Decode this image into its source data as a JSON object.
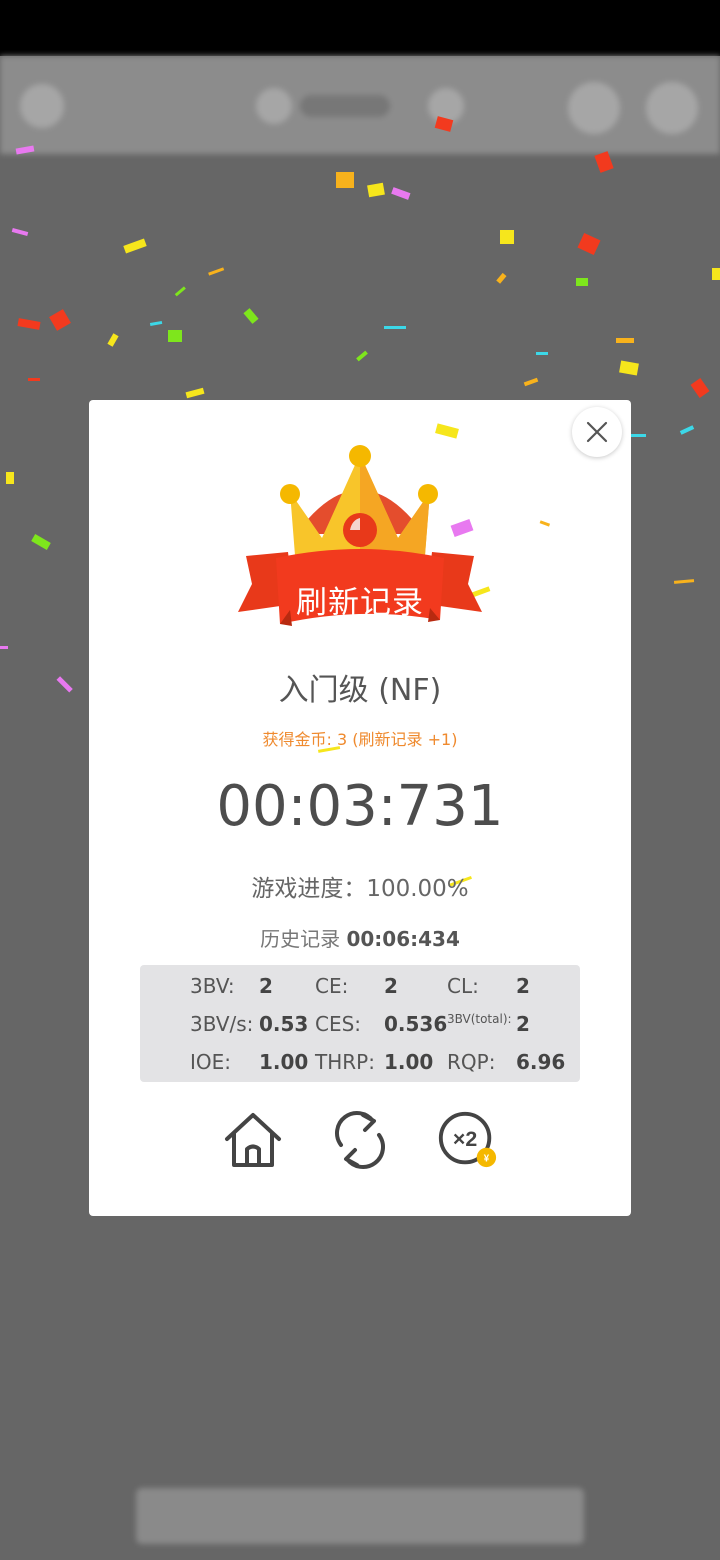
{
  "dialog": {
    "banner_text": "刷新记录",
    "level": "入门级 (NF)",
    "coins": "获得金币: 3 (刷新记录 +1)",
    "time": "00:03:731",
    "progress_label": "游戏进度：",
    "progress_value": "100.00%",
    "history_label": "历史记录",
    "history_value": "00:06:434",
    "stats": {
      "bv": {
        "label": "3BV:",
        "value": "2"
      },
      "ce": {
        "label": "CE:",
        "value": "2"
      },
      "cl": {
        "label": "CL:",
        "value": "2"
      },
      "bvs": {
        "label": "3BV/s:",
        "value": "0.53"
      },
      "ces": {
        "label": "CES:",
        "value": "0.536"
      },
      "bvtotal": {
        "label": "3BV(total):",
        "value": "2"
      },
      "ioe": {
        "label": "IOE:",
        "value": "1.00"
      },
      "thrp": {
        "label": "THRP:",
        "value": "1.00"
      },
      "rqp": {
        "label": "RQP:",
        "value": "6.96"
      }
    },
    "actions": {
      "home_icon": "home-icon",
      "restart_icon": "refresh-icon",
      "double_icon": "x2-coin-icon",
      "double_text": "×2",
      "coin_symbol": "¥"
    }
  },
  "colors": {
    "overlay": "#666666",
    "dialog_bg": "#ffffff",
    "ribbon": "#e8391a",
    "crown_gold": "#f8c52a",
    "coins_text": "#ef8a2e",
    "stats_bg": "#e3e3e5"
  }
}
